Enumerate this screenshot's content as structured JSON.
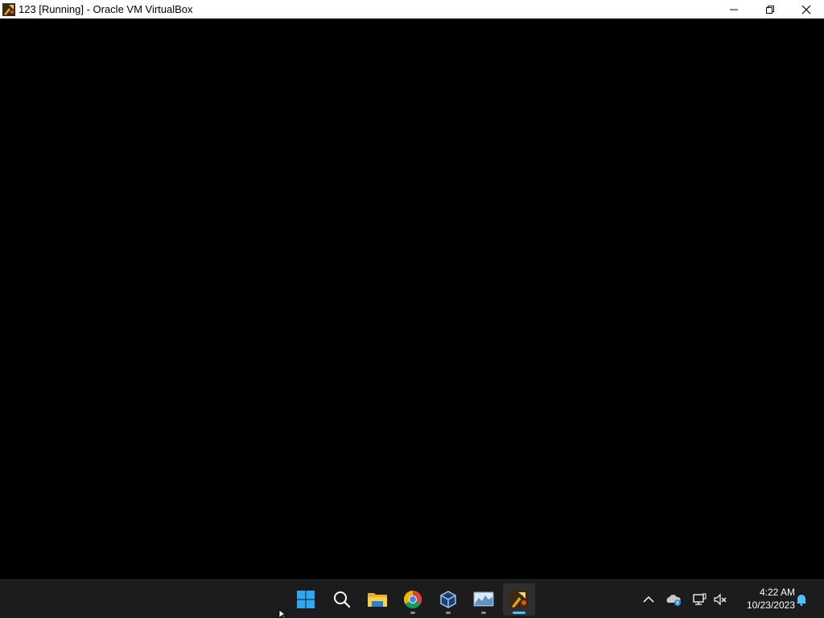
{
  "window": {
    "title": "123 [Running] - Oracle VM VirtualBox",
    "icon": "virtualbox-vm-icon",
    "controls": [
      "minimize",
      "restore",
      "close"
    ]
  },
  "vm_screen": {
    "state": "black screen"
  },
  "taskbar": {
    "apps": [
      {
        "name": "start",
        "icon": "windows-logo-icon",
        "running": false
      },
      {
        "name": "search",
        "icon": "search-icon",
        "running": false
      },
      {
        "name": "file-explorer",
        "icon": "folder-icon",
        "running": false
      },
      {
        "name": "chrome",
        "icon": "chrome-icon",
        "running": true
      },
      {
        "name": "virtualbox",
        "icon": "virtualbox-cube-icon",
        "running": true
      },
      {
        "name": "task-manager",
        "icon": "performance-monitor-icon",
        "running": true
      },
      {
        "name": "vm-window",
        "icon": "virtualbox-vm-icon",
        "running": true,
        "active": true
      }
    ],
    "tray": {
      "icons": [
        "chevron-up-icon",
        "onedrive-icon",
        "network-icon",
        "sound-muted-icon",
        "notification-bell-icon"
      ]
    },
    "clock": {
      "time": "4:22 AM",
      "date": "10/23/2023"
    }
  },
  "colors": {
    "taskbar_bg": "#1c1c1c",
    "accent": "#4cc2ff",
    "titlebar_bg": "#ffffff"
  }
}
